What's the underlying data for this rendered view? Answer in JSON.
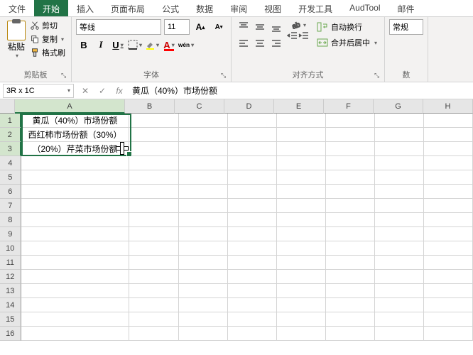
{
  "tabs": [
    "文件",
    "开始",
    "插入",
    "页面布局",
    "公式",
    "数据",
    "审阅",
    "视图",
    "开发工具",
    "AudTool",
    "邮件"
  ],
  "activeTab": 1,
  "clipboard": {
    "paste": "粘贴",
    "cut": "剪切",
    "copy": "复制",
    "format": "格式刷",
    "group": "剪贴板"
  },
  "font": {
    "name": "等线",
    "size": "11",
    "group": "字体"
  },
  "align": {
    "wrap": "自动换行",
    "merge": "合并后居中",
    "group": "对齐方式"
  },
  "number": {
    "format": "常规",
    "group": "数"
  },
  "nameBox": "3R x 1C",
  "formula": "黄瓜（40%）市场份额",
  "columns": [
    "A",
    "B",
    "C",
    "D",
    "E",
    "F",
    "G",
    "H"
  ],
  "rowNums": [
    1,
    2,
    3,
    4,
    5,
    6,
    7,
    8,
    9,
    10,
    11,
    12,
    13,
    14,
    15,
    16
  ],
  "cells": {
    "A1": "黄瓜（40%）市场份额",
    "A2": "西红柿市场份额（30%）",
    "A3": "（20%）芹菜市场份额"
  },
  "chart_data": {
    "type": "table",
    "title": "市场份额",
    "series": [
      {
        "name": "黄瓜",
        "value": 40
      },
      {
        "name": "西红柿",
        "value": 30
      },
      {
        "name": "芹菜",
        "value": 20
      }
    ]
  }
}
